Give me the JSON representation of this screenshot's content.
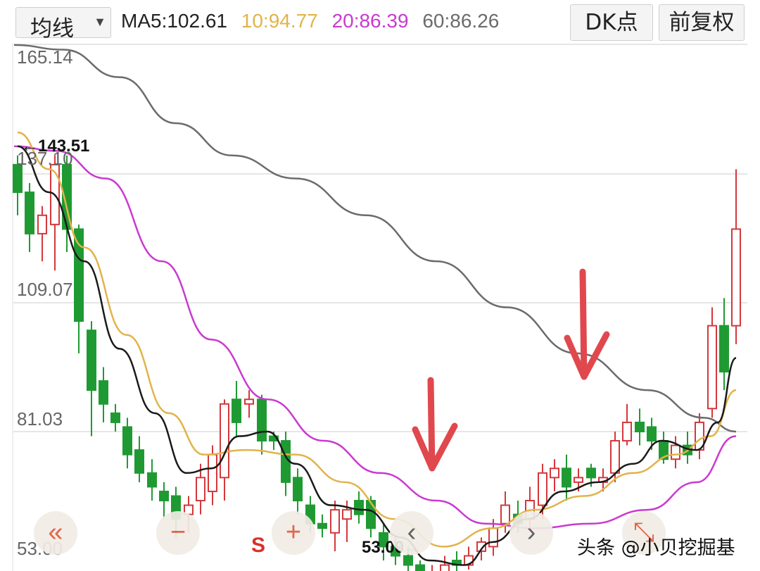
{
  "toolbar": {
    "ma_select_label": "均线",
    "ma5": "MA5:102.61",
    "ma10": "10:94.77",
    "ma20": "20:86.39",
    "ma60": "60:86.26",
    "dk_button": "DK点",
    "fq_button": "前复权"
  },
  "colors": {
    "ma5": "#1a1a1a",
    "ma10": "#e2b349",
    "ma20": "#c93ad0",
    "ma60": "#6b6b6b",
    "up": "#d3383b",
    "down": "#1f9a33"
  },
  "chart": {
    "y_labels": [
      "165.14",
      "137.10",
      "109.07",
      "81.03",
      "53.00"
    ],
    "high_label": "←143.51",
    "low_label": "53.00→"
  },
  "chart_data": {
    "type": "candlestick",
    "y_axis_ticks": [
      165.14,
      137.1,
      109.07,
      81.03,
      53.0
    ],
    "period_high": 143.51,
    "period_low": 53.0,
    "moving_averages": [
      {
        "name": "MA5",
        "last": 102.61
      },
      {
        "name": "MA10",
        "last": 94.77
      },
      {
        "name": "MA20",
        "last": 86.39
      },
      {
        "name": "MA60",
        "last": 86.26
      }
    ],
    "annotations": [
      "down-arrow",
      "down-arrow"
    ]
  },
  "controls": {
    "left": "«",
    "minus": "−",
    "plus": "+",
    "prev": "‹",
    "next": "›",
    "expand": "⤡"
  },
  "s_mark": "S",
  "watermark": "头条 @小贝挖掘基"
}
